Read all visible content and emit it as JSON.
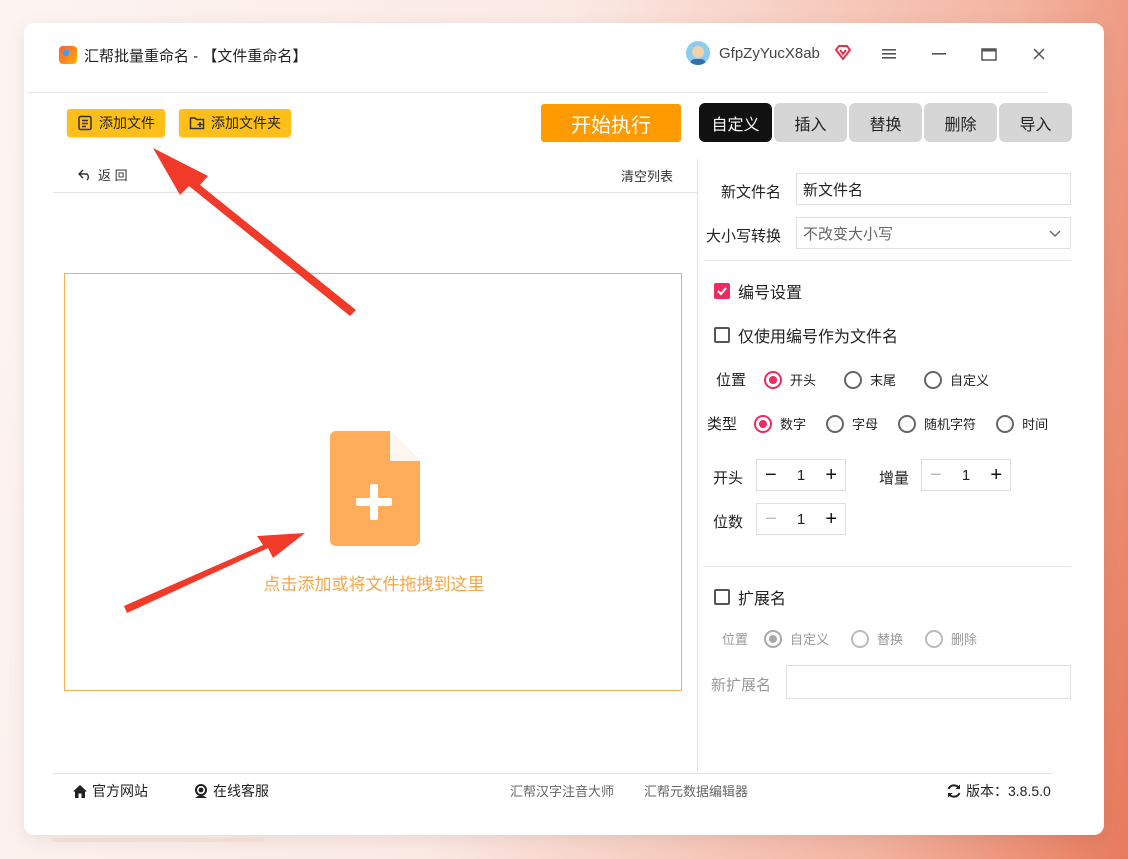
{
  "title": "汇帮批量重命名 - 【文件重命名】",
  "user": {
    "name": "GfpZyYucX8ab"
  },
  "toolbar": {
    "add_file": "添加文件",
    "add_folder": "添加文件夹",
    "start": "开始执行"
  },
  "tabs": [
    "自定义",
    "插入",
    "替换",
    "删除",
    "导入"
  ],
  "list": {
    "back": "返 回",
    "clear": "清空列表",
    "drop_hint": "点击添加或将文件拖拽到这里"
  },
  "panel": {
    "new_name_label": "新文件名",
    "new_name_value": "新文件名",
    "case_label": "大小写转换",
    "case_value": "不改变大小写",
    "numbering_label": "编号设置",
    "numbering_checked": true,
    "only_number_label": "仅使用编号作为文件名",
    "only_number_checked": false,
    "position_label": "位置",
    "position_options": [
      "开头",
      "末尾",
      "自定义"
    ],
    "position_selected": "开头",
    "type_label": "类型",
    "type_options": [
      "数字",
      "字母",
      "随机字符",
      "时间"
    ],
    "type_selected": "数字",
    "start_label": "开头",
    "start_value": "1",
    "increment_label": "增量",
    "increment_value": "1",
    "digits_label": "位数",
    "digits_value": "1",
    "ext_label": "扩展名",
    "ext_checked": false,
    "ext_position_label": "位置",
    "ext_options": [
      "自定义",
      "替换",
      "删除"
    ],
    "ext_selected": "自定义",
    "new_ext_label": "新扩展名",
    "new_ext_value": ""
  },
  "footer": {
    "website": "官方网站",
    "support": "在线客服",
    "link1": "汇帮汉字注音大师",
    "link2": "汇帮元数据编辑器",
    "version": "版本：3.8.5.0"
  },
  "colors": {
    "accent": "#ee2a5e",
    "primary_button": "#ff9a00",
    "toolbar_button": "#ffbf1a",
    "drop_hint": "#f4a64a"
  }
}
